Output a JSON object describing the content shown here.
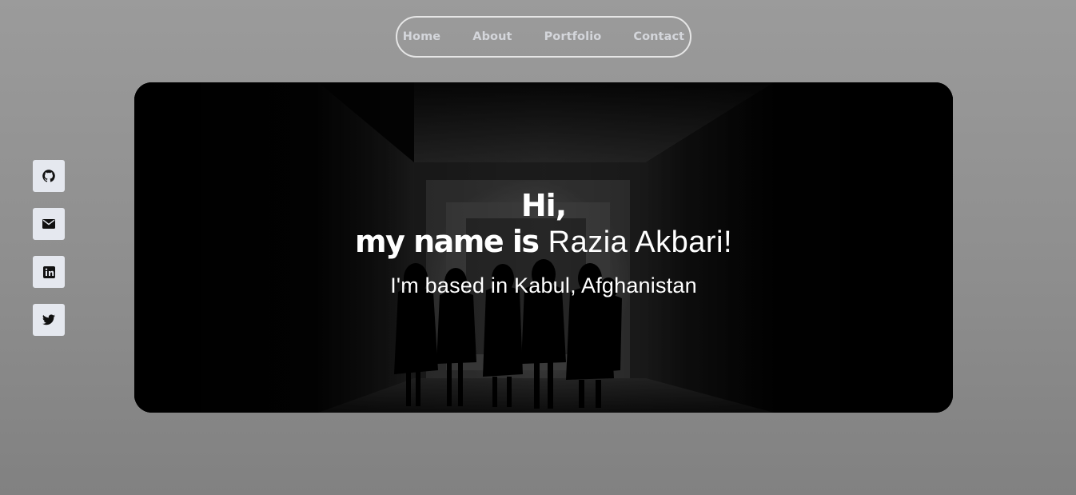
{
  "nav": {
    "items": [
      {
        "label": "Home"
      },
      {
        "label": "About"
      },
      {
        "label": "Portfolio"
      },
      {
        "label": "Contact"
      }
    ]
  },
  "social": {
    "items": [
      {
        "icon": "github-icon"
      },
      {
        "icon": "envelope-icon"
      },
      {
        "icon": "linkedin-icon"
      },
      {
        "icon": "twitter-icon"
      }
    ]
  },
  "hero": {
    "greeting_line1": "Hi,",
    "greeting_prefix": "my name is",
    "name": "Razia Akbari!",
    "location": "I'm based in Kabul, Afghanistan",
    "image_description": "silhouettes of women walking down a dark corridor"
  },
  "colors": {
    "page_background": "#929292",
    "nav_text": "#d4d6db",
    "nav_border": "#e6e6e6",
    "social_button_bg": "#e5e8ef",
    "hero_text": "#ffffff"
  }
}
